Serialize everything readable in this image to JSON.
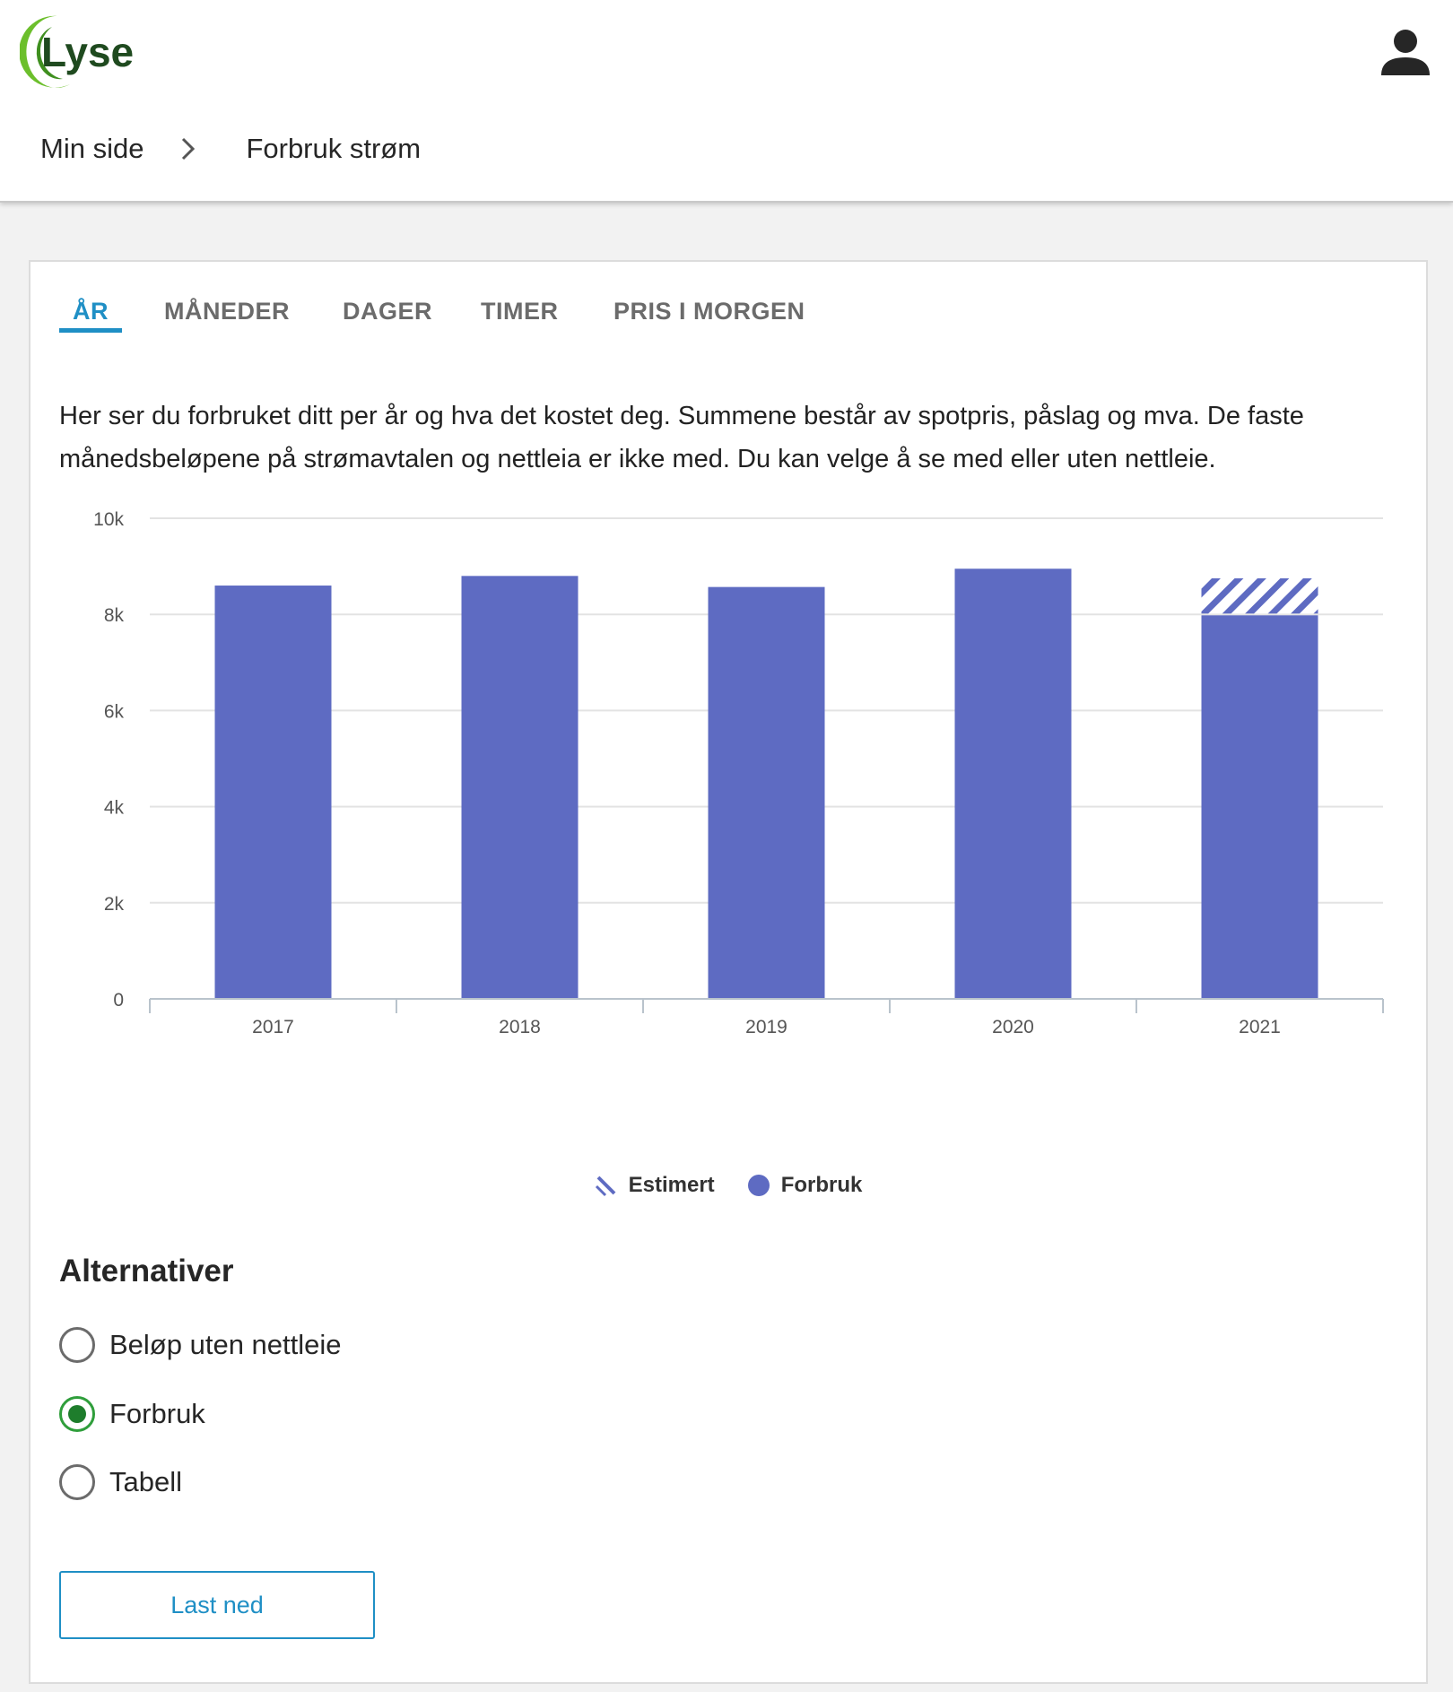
{
  "header": {
    "logo_text": "Lyse",
    "breadcrumb": [
      {
        "label": "Min side"
      },
      {
        "label": "Forbruk strøm"
      }
    ]
  },
  "tabs": [
    {
      "label": "ÅR",
      "active": true
    },
    {
      "label": "MÅNEDER",
      "active": false
    },
    {
      "label": "DAGER",
      "active": false
    },
    {
      "label": "TIMER",
      "active": false
    },
    {
      "label": "PRIS I MORGEN",
      "active": false
    }
  ],
  "description": "Her ser du forbruket ditt per år og hva det kostet deg. Summene består av spotpris, påslag og mva. De faste månedsbeløpene på strømavtalen og nettleia er ikke med. Du kan velge å se med eller uten nettleie.",
  "chart_data": {
    "type": "bar",
    "stacked": true,
    "categories": [
      "2017",
      "2018",
      "2019",
      "2020",
      "2021"
    ],
    "series": [
      {
        "name": "Forbruk",
        "values": [
          8600,
          8800,
          8570,
          8950,
          7980
        ],
        "color": "#5e6bc2"
      },
      {
        "name": "Estimert",
        "values": [
          0,
          0,
          0,
          0,
          770
        ],
        "color": "#5e6bc2",
        "pattern": "diagonal-stripes"
      }
    ],
    "ylim": [
      0,
      10000
    ],
    "yticks": [
      {
        "value": 0,
        "label": "0"
      },
      {
        "value": 2000,
        "label": "2k"
      },
      {
        "value": 4000,
        "label": "4k"
      },
      {
        "value": 6000,
        "label": "6k"
      },
      {
        "value": 8000,
        "label": "8k"
      },
      {
        "value": 10000,
        "label": "10k"
      }
    ],
    "grid": true,
    "legend": [
      "Estimert",
      "Forbruk"
    ],
    "legend_position": "bottom"
  },
  "alternatives": {
    "heading": "Alternativer",
    "options": [
      {
        "label": "Beløp uten nettleie",
        "checked": false
      },
      {
        "label": "Forbruk",
        "checked": true
      },
      {
        "label": "Tabell",
        "checked": false
      }
    ]
  },
  "download_label": "Last ned",
  "colors": {
    "accent": "#1f8fc5",
    "bar": "#5e6bc2",
    "radio_checked": "#1e7d2c",
    "logo_green": "#6cbf2c",
    "logo_dark": "#1f4a1f"
  }
}
